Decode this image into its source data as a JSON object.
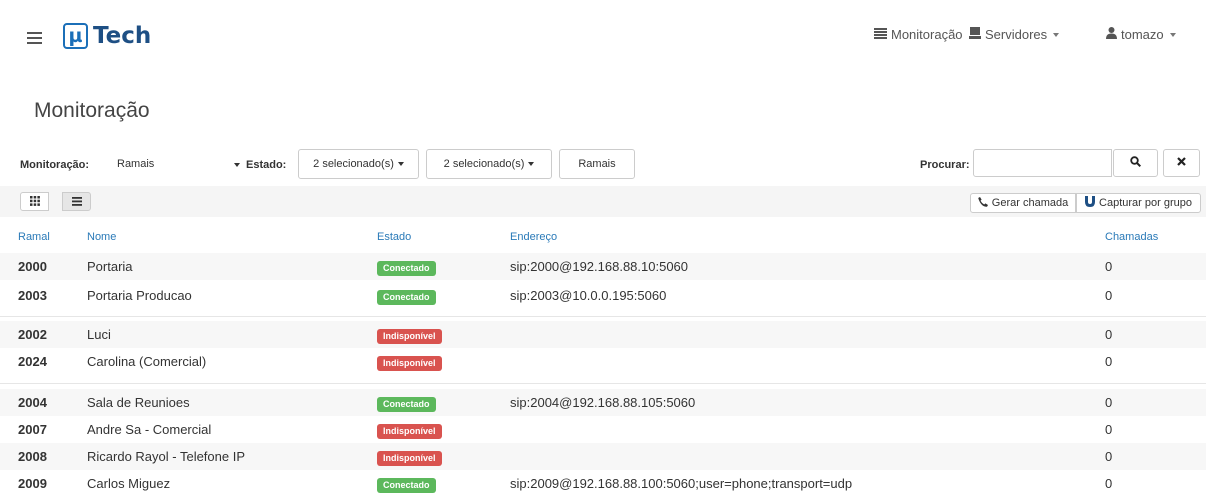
{
  "navbar": {
    "logo_mu": "µ",
    "logo_text": "Tech",
    "monitoracao": "Monitoração",
    "servidores": "Servidores",
    "user": "tomazo"
  },
  "page": {
    "title": "Monitoração"
  },
  "filters": {
    "monitoracao_label": "Monitoração:",
    "monitoracao_value": "Ramais",
    "estado_label": "Estado:",
    "btn1": "2 selecionado(s)",
    "btn2": "2 selecionado(s)",
    "btn3": "Ramais",
    "procurar_label": "Procurar:",
    "search_placeholder": ""
  },
  "toolbar": {
    "gerar_chamada": "Gerar chamada",
    "capturar_grupo": "Capturar por grupo"
  },
  "table": {
    "headers": {
      "ramal": "Ramal",
      "nome": "Nome",
      "estado": "Estado",
      "endereco": "Endereço",
      "chamadas": "Chamadas"
    },
    "rows": [
      {
        "ramal": "2000",
        "nome": "Portaria",
        "estado": "Conectado",
        "status": "ok",
        "endereco": "sip:2000@192.168.88.10:5060",
        "chamadas": "0"
      },
      {
        "ramal": "2003",
        "nome": "Portaria Producao",
        "estado": "Conectado",
        "status": "ok",
        "endereco": "sip:2003@10.0.0.195:5060",
        "chamadas": "0"
      },
      {
        "ramal": "2002",
        "nome": "Luci",
        "estado": "Indisponível",
        "status": "down",
        "endereco": "",
        "chamadas": "0"
      },
      {
        "ramal": "2024",
        "nome": "Carolina (Comercial)",
        "estado": "Indisponível",
        "status": "down",
        "endereco": "",
        "chamadas": "0"
      },
      {
        "ramal": "2004",
        "nome": "Sala de Reunioes",
        "estado": "Conectado",
        "status": "ok",
        "endereco": "sip:2004@192.168.88.105:5060",
        "chamadas": "0"
      },
      {
        "ramal": "2007",
        "nome": "Andre Sa - Comercial",
        "estado": "Indisponível",
        "status": "down",
        "endereco": "",
        "chamadas": "0"
      },
      {
        "ramal": "2008",
        "nome": "Ricardo Rayol - Telefone IP",
        "estado": "Indisponível",
        "status": "down",
        "endereco": "",
        "chamadas": "0"
      },
      {
        "ramal": "2009",
        "nome": "Carlos Miguez",
        "estado": "Conectado",
        "status": "ok",
        "endereco": "sip:2009@192.168.88.100:5060;user=phone;transport=udp",
        "chamadas": "0"
      }
    ]
  },
  "colors": {
    "brand": "#1b6fb8",
    "link": "#2a7ab8",
    "success": "#5cb85c",
    "danger": "#d9534f"
  }
}
